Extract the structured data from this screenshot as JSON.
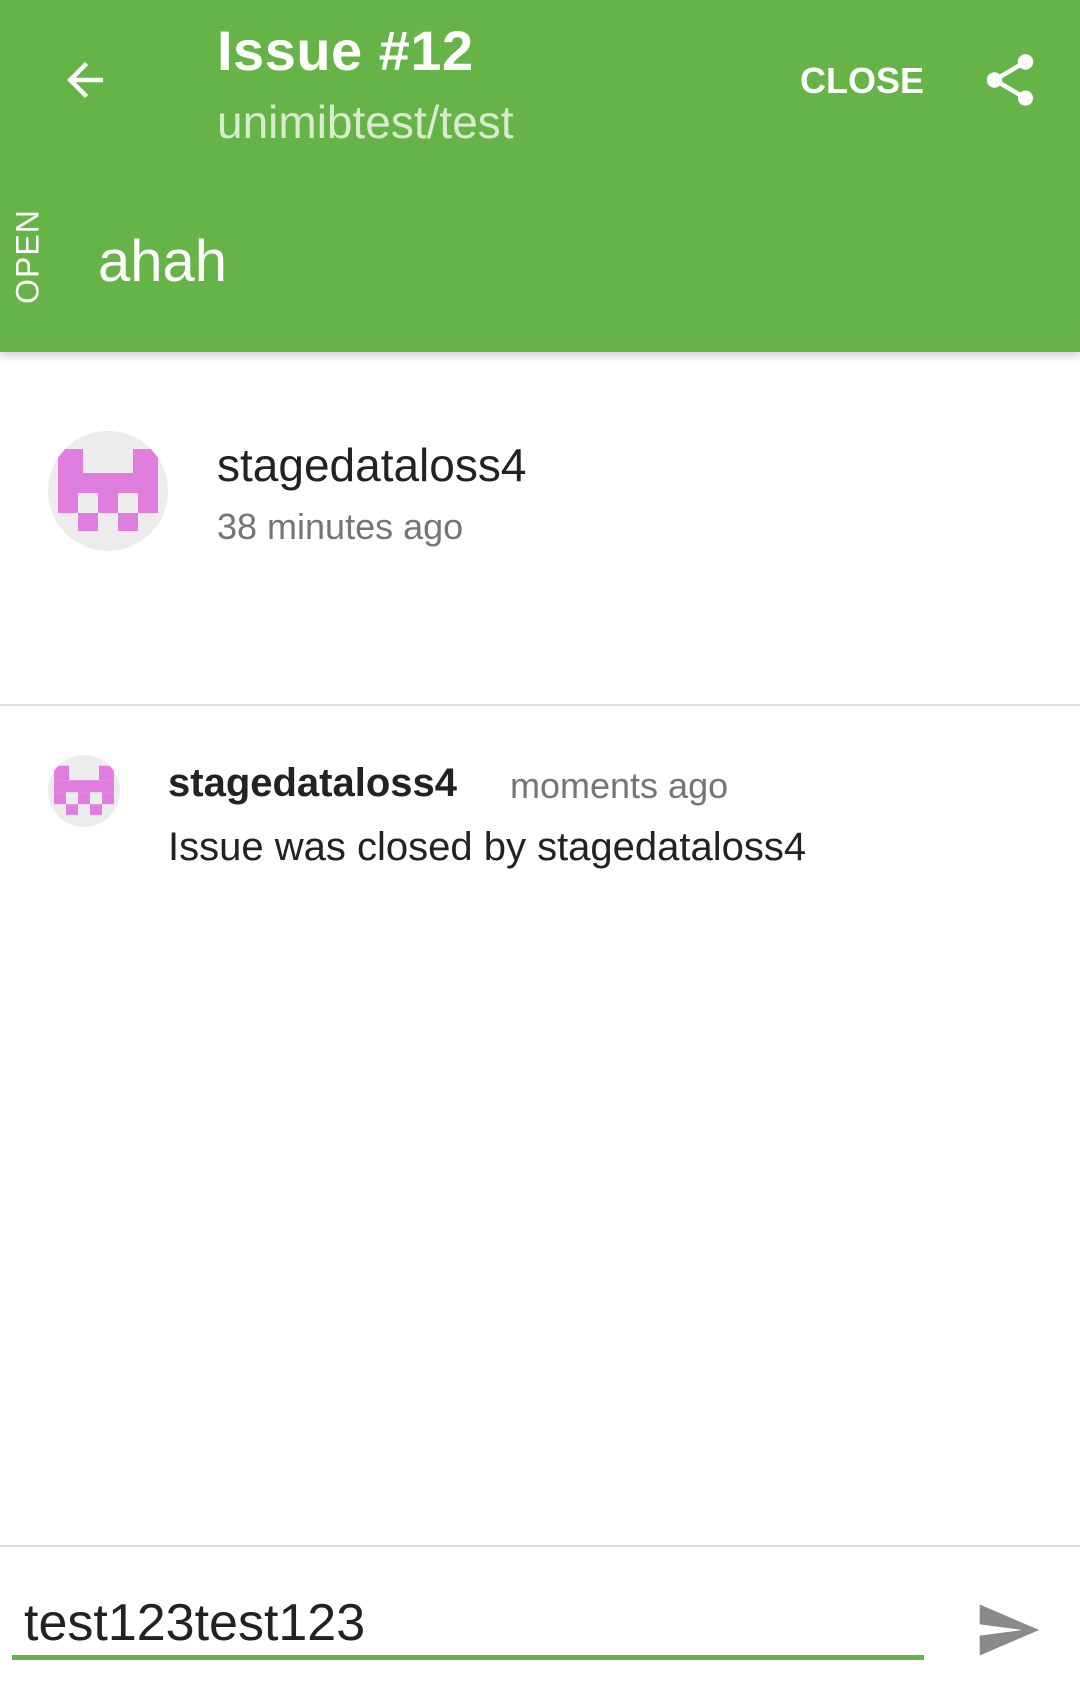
{
  "colors": {
    "primary": "#66b347",
    "avatar_pink": "#e07ee0",
    "avatar_bg": "#ececec",
    "secondary_text": "#757575"
  },
  "header": {
    "back_icon": "arrow-left-icon",
    "title": "Issue #12",
    "subtitle": "unimibtest/test",
    "close_label": "CLOSE",
    "share_icon": "share-icon",
    "state_label": "OPEN",
    "issue_title": "ahah"
  },
  "description": {
    "author": "stagedataloss4",
    "time": "38 minutes ago",
    "avatar_icon": "identicon-avatar"
  },
  "timeline": [
    {
      "user": "stagedataloss4",
      "time": "moments ago",
      "text": "Issue was closed by stagedataloss4",
      "avatar_icon": "identicon-avatar"
    }
  ],
  "comment_box": {
    "value": "test123test123",
    "send_icon": "send-icon"
  }
}
